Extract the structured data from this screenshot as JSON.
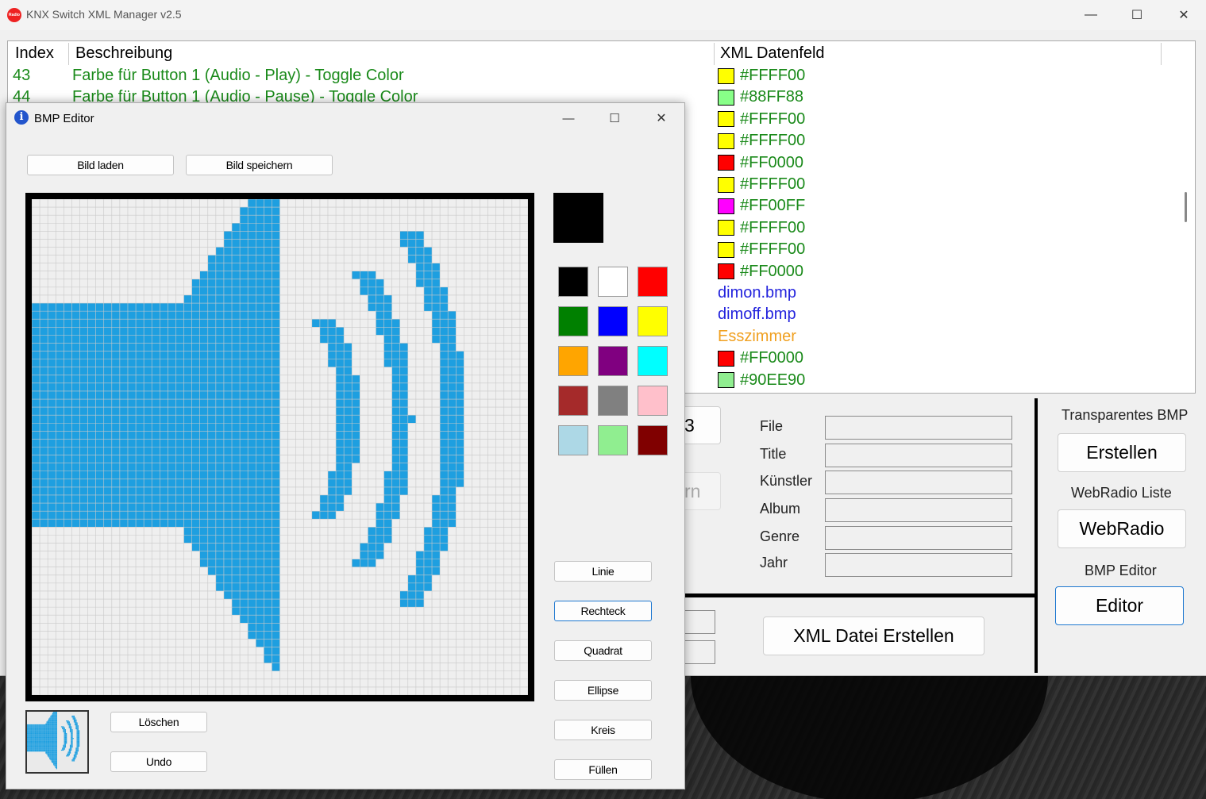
{
  "app": {
    "title": "KNX Switch XML Manager v2.5",
    "icon_text": "Radio"
  },
  "grid": {
    "headers": {
      "index": "Index",
      "description": "Beschreibung",
      "xml": "XML Datenfeld"
    },
    "rows": [
      {
        "index": "43",
        "description": "Farbe für Button 1 (Audio - Play) - Toggle Color",
        "xml": "#FFFF00",
        "swatch": "#FFFF00",
        "color": "#1a8a1a"
      },
      {
        "index": "44",
        "description": "Farbe für Button 1 (Audio - Pause) - Toggle Color",
        "xml": "#88FF88",
        "swatch": "#88FF88",
        "color": "#1a8a1a"
      },
      {
        "index": "",
        "description": "",
        "xml": "#FFFF00",
        "swatch": "#FFFF00",
        "color": "#1a8a1a"
      },
      {
        "index": "",
        "description": "",
        "xml": "#FFFF00",
        "swatch": "#FFFF00",
        "color": "#1a8a1a"
      },
      {
        "index": "",
        "description": "",
        "xml": "#FF0000",
        "swatch": "#FF0000",
        "color": "#1a8a1a"
      },
      {
        "index": "",
        "description": "",
        "xml": "#FFFF00",
        "swatch": "#FFFF00",
        "color": "#1a8a1a"
      },
      {
        "index": "",
        "description": "",
        "xml": "#FF00FF",
        "swatch": "#FF00FF",
        "color": "#1a8a1a"
      },
      {
        "index": "",
        "description": "",
        "xml": "#FFFF00",
        "swatch": "#FFFF00",
        "color": "#1a8a1a"
      },
      {
        "index": "",
        "description": "",
        "xml": "#FFFF00",
        "swatch": "#FFFF00",
        "color": "#1a8a1a"
      },
      {
        "index": "",
        "description": "",
        "xml": "#FF0000",
        "swatch": "#FF0000",
        "color": "#1a8a1a"
      },
      {
        "index": "",
        "description": "",
        "xml": "dimon.bmp",
        "swatch": "",
        "color": "#2222dd"
      },
      {
        "index": "",
        "description": "",
        "xml": "dimoff.bmp",
        "swatch": "",
        "color": "#2222dd"
      },
      {
        "index": "",
        "description": "",
        "xml": "Esszimmer",
        "swatch": "",
        "color": "#f0a020"
      },
      {
        "index": "",
        "description": "",
        "xml": "#FF0000",
        "swatch": "#FF0000",
        "color": "#1a8a1a"
      },
      {
        "index": "",
        "description": "",
        "xml": "#90EE90",
        "swatch": "#90EE90",
        "color": "#1a8a1a"
      }
    ]
  },
  "metadata_panel": {
    "labels": [
      "File",
      "Title",
      "Künstler",
      "Album",
      "Genre",
      "Jahr"
    ],
    "values": [
      "",
      "",
      "",
      "",
      "",
      ""
    ],
    "partial_button_1": "3",
    "partial_button_2": "rn"
  },
  "right_panel": {
    "transparent_label": "Transparentes BMP",
    "transparent_button": "Erstellen",
    "webradio_label": "WebRadio Liste",
    "webradio_button": "WebRadio",
    "bmp_label": "BMP Editor",
    "bmp_button": "Editor"
  },
  "xml_create_button": "XML Datei Erstellen",
  "bmp_editor": {
    "title": "BMP Editor",
    "load_button": "Bild laden",
    "save_button": "Bild speichern",
    "current_color": "#000000",
    "palette": [
      "#000000",
      "#FFFFFF",
      "#FF0000",
      "#008000",
      "#0000FF",
      "#FFFF00",
      "#FFA500",
      "#800080",
      "#00FFFF",
      "#A52A2A",
      "#808080",
      "#FFC0CB",
      "#ADD8E6",
      "#90EE90",
      "#800000"
    ],
    "tools": [
      "Linie",
      "Rechteck",
      "Quadrat",
      "Ellipse",
      "Kreis",
      "Füllen"
    ],
    "selected_tool": "Rechteck",
    "clear_button": "Löschen",
    "undo_button": "Undo",
    "pixel_color": "#1E9FE0",
    "grid_size": 62
  }
}
